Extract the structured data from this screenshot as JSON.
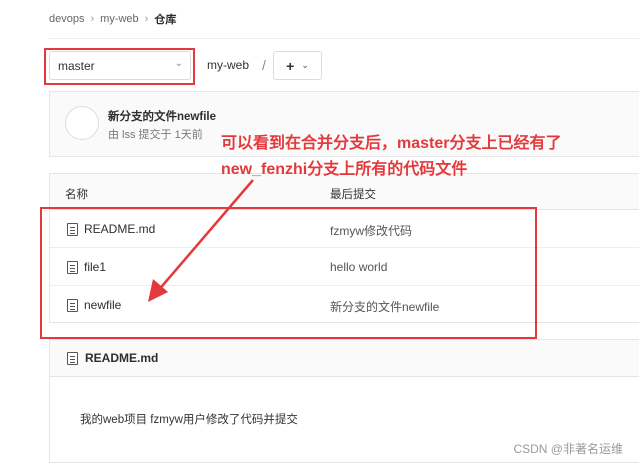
{
  "breadcrumb": {
    "items": [
      "devops",
      "my-web",
      "仓库"
    ]
  },
  "toolbar": {
    "branch": "master",
    "repo_path": "my-web",
    "path_sep": "/",
    "add_label": "+"
  },
  "last_commit": {
    "title": "新分支的文件newfile",
    "meta": "由 lss 提交于 1天前"
  },
  "files": {
    "col_name": "名称",
    "col_commit": "最后提交",
    "rows": [
      {
        "name": "README.md",
        "commit": "fzmyw修改代码"
      },
      {
        "name": "file1",
        "commit": "hello world"
      },
      {
        "name": "newfile",
        "commit": "新分支的文件newfile"
      }
    ]
  },
  "readme": {
    "title": "README.md",
    "content": "我的web项目 fzmyw用户修改了代码并提交"
  },
  "annotation": {
    "line1": "可以看到在合并分支后，master分支上已经有了",
    "line2": "new_fenzhi分支上所有的代码文件",
    "color": "#e4393c"
  },
  "watermark": "CSDN @非著名运维"
}
